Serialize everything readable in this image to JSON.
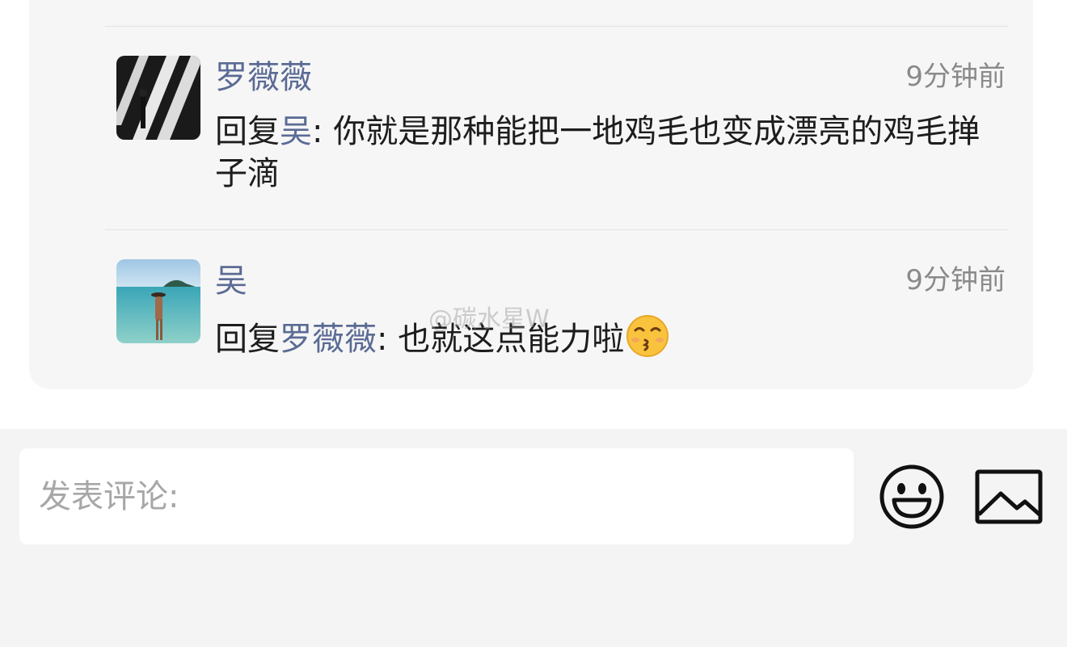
{
  "comments": [
    {
      "author": "罗薇薇",
      "time": "9分钟前",
      "reply_prefix": "回复",
      "reply_to": "吴",
      "reply_sep": ": ",
      "content": "你就是那种能把一地鸡毛也变成漂亮的鸡毛掸子滴"
    },
    {
      "author": "吴",
      "time": "9分钟前",
      "reply_prefix": "回复",
      "reply_to": "罗薇薇",
      "reply_sep": ": ",
      "content": "也就这点能力啦",
      "emoji": "kissing-smiling-eyes-emoji"
    }
  ],
  "watermark": "@碳水星W",
  "composer": {
    "placeholder": "发表评论:",
    "emoji_icon": "smiley-face-icon",
    "image_icon": "image-picture-icon"
  },
  "colors": {
    "mention": "#5a6b94",
    "thread_bg": "#f6f6f6",
    "composer_bg": "#f4f4f4"
  }
}
